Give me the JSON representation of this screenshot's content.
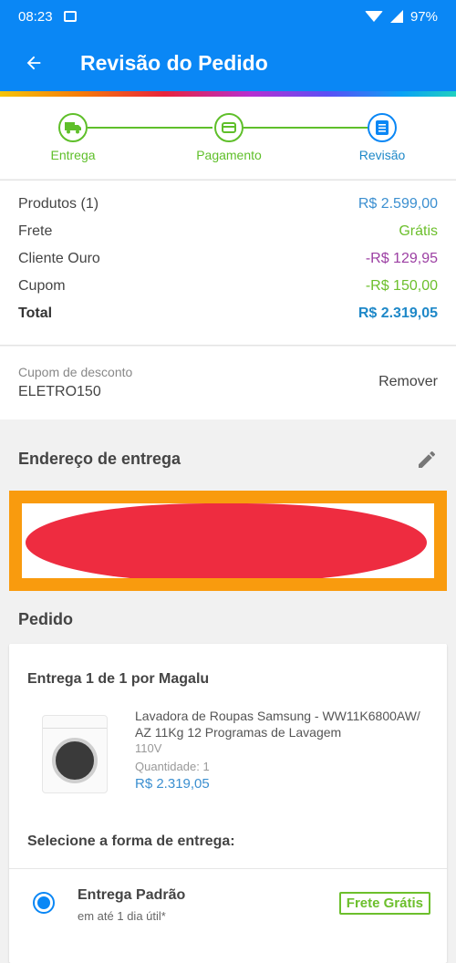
{
  "status_bar": {
    "time": "08:23",
    "battery": "97%"
  },
  "app_bar": {
    "title": "Revisão do Pedido"
  },
  "stepper": {
    "steps": [
      {
        "label": "Entrega",
        "icon": "truck-icon"
      },
      {
        "label": "Pagamento",
        "icon": "card-icon"
      },
      {
        "label": "Revisão",
        "icon": "document-icon"
      }
    ],
    "active_index": 2
  },
  "summary": {
    "rows": [
      {
        "label": "Produtos (1)",
        "value": "R$ 2.599,00"
      },
      {
        "label": "Frete",
        "value": "Grátis"
      },
      {
        "label": "Cliente Ouro",
        "value": "-R$ 129,95"
      },
      {
        "label": "Cupom",
        "value": "-R$ 150,00"
      },
      {
        "label": "Total",
        "value": "R$ 2.319,05"
      }
    ]
  },
  "coupon": {
    "label": "Cupom de desconto",
    "code": "ELETRO150",
    "remove_label": "Remover"
  },
  "address": {
    "title": "Endereço de entrega",
    "edit_icon": "pencil-icon"
  },
  "order": {
    "title": "Pedido",
    "delivery_title": "Entrega 1 de 1 por Magalu",
    "product": {
      "name": "Lavadora de Roupas Samsung - WW11K6800AW/ AZ 11Kg 12 Programas de Lavagem",
      "voltage": "110V",
      "quantity": "Quantidade:  1",
      "price": "R$ 2.319,05"
    },
    "select_label": "Selecione a forma de entrega:",
    "shipping": {
      "name": "Entrega Padrão",
      "eta": "em até 1 dia útil*",
      "badge": "Frete Grátis",
      "selected": true
    }
  },
  "colors": {
    "primary": "#0a87f5",
    "green": "#6cbf2c",
    "purple": "#9c3fa3",
    "price_blue": "#3b8fd0",
    "highlight_orange": "#f99b0e",
    "redaction_red": "#ee2c40"
  }
}
